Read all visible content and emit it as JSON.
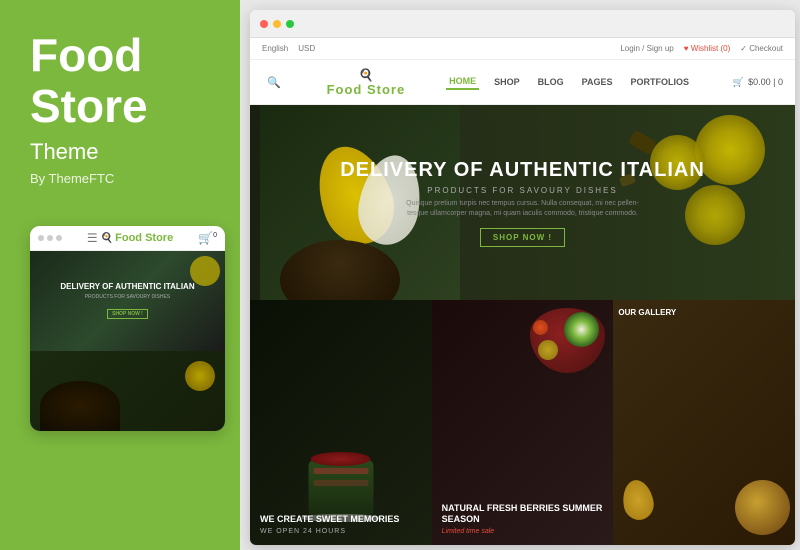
{
  "left_panel": {
    "title_line1": "Food",
    "title_line2": "Store",
    "subtitle": "Theme",
    "by_text": "By ThemeFTC"
  },
  "mobile_mockup": {
    "logo_text": "Food Store",
    "hero_title": "DELIVERY OF AUTHENTIC ITALIAN",
    "hero_subtitle": "PRODUCTS FOR SAVOURY DISHES",
    "shop_now": "SHOP NOW !"
  },
  "browser": {
    "utility_bar": {
      "language": "English",
      "currency": "USD",
      "login": "Login / Sign up",
      "wishlist": "♥ Wishlist (0)",
      "checkout": "✓ Checkout"
    },
    "header": {
      "logo": "Food Store",
      "chef_hat": "🍳",
      "nav_items": [
        {
          "label": "HOME",
          "active": true
        },
        {
          "label": "SHOP",
          "active": false
        },
        {
          "label": "BLOG",
          "active": false
        },
        {
          "label": "PAGES",
          "active": false
        },
        {
          "label": "PORTFOLIOS",
          "active": false
        }
      ],
      "cart_label": "$0.00 | 0"
    },
    "hero": {
      "title": "DELIVERY OF AUTHENTIC ITALIAN",
      "subtitle": "PRODUCTS FOR SAVOURY DISHES",
      "description": "Quisque pretium turpis nec tempus cursus. Nulla consequat, mi nec pellen-tesque ullamcorper magna, mi quam iaculis commodo, tristique commodo.",
      "cta": "SHOP NOW !"
    },
    "cards": [
      {
        "id": "sweet-memories",
        "title": "WE CREATE SWEET MEMORIES",
        "subtitle": "WE OPEN 24 HOURS",
        "sale": null
      },
      {
        "id": "fresh-berries",
        "title": "NATURAL FRESH BERRIES SUMMER SEASON",
        "subtitle": null,
        "sale": "Limited time sale"
      },
      {
        "id": "gallery",
        "title": "OUR GALLERY",
        "subtitle": null,
        "sale": null
      }
    ]
  },
  "colors": {
    "green": "#7cb83e",
    "dark": "#1a1a1a",
    "white": "#ffffff",
    "accent_red": "#e74c3c"
  }
}
